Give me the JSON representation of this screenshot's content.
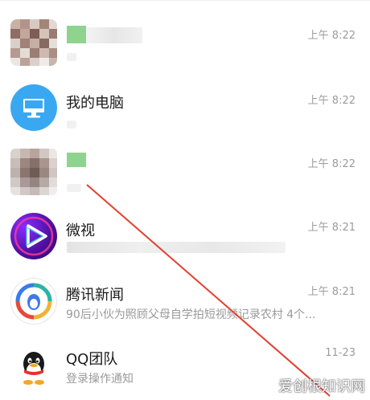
{
  "chat_list": [
    {
      "title": "",
      "subtitle": "",
      "time": "上午 8:22"
    },
    {
      "title": "我的电脑",
      "subtitle": "",
      "time": "上午 8:22"
    },
    {
      "title": "",
      "subtitle": "",
      "time": "上午 8:22"
    },
    {
      "title": "微视",
      "subtitle": "",
      "time": "上午 8:21"
    },
    {
      "title": "腾讯新闻",
      "subtitle": "90后小伙为照顾父母自学拍短视频记录农村 4个...",
      "time": "上午 8:21"
    },
    {
      "title": "QQ团队",
      "subtitle": "登录操作通知",
      "time": "11-23"
    }
  ],
  "icons": {
    "computer": "computer-icon",
    "weishi": "weishi-play-icon",
    "news": "tencent-news-icon",
    "qq": "qq-penguin-icon"
  },
  "colors": {
    "computer_bg": "#3aa8f0",
    "annotation": "#e2402e",
    "green_block": "#8fd48e"
  },
  "watermark": "爱创根知识网"
}
